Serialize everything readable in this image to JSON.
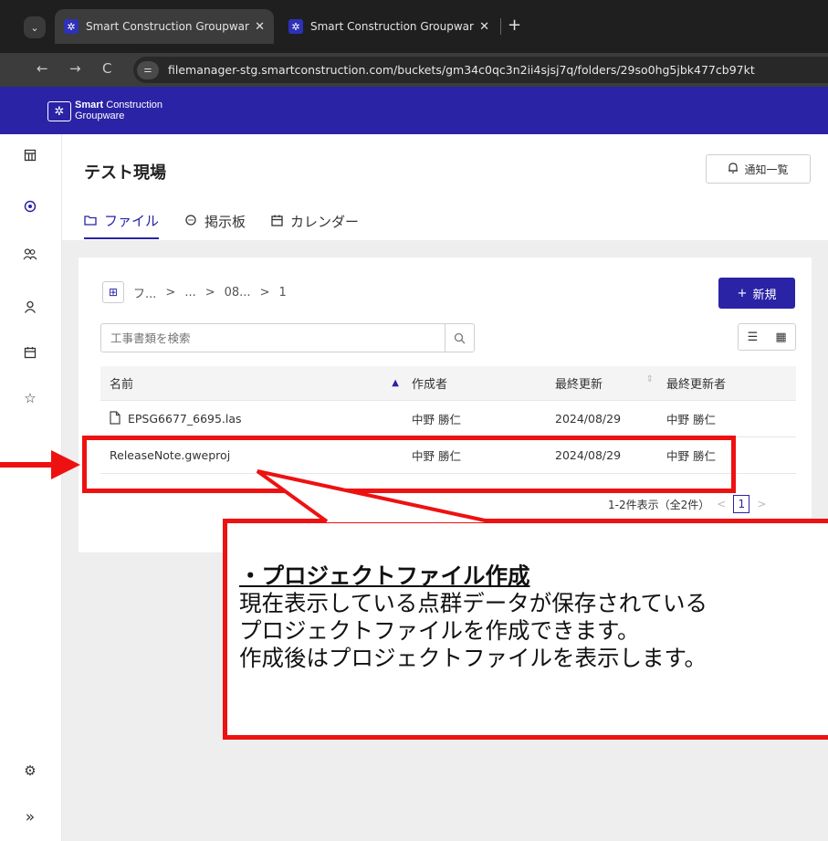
{
  "browser": {
    "tabs": [
      {
        "title": "Smart Construction Groupware",
        "close": "✕"
      },
      {
        "title": "Smart Construction Groupware",
        "close": "✕"
      }
    ],
    "tab_strip_icon": "chevron-down-icon",
    "new_tab": "+",
    "url": "filemanager-stg.smartconstruction.com/buckets/gm34c0qc3n2ii4sjsj7q/folders/29so0hg5jbk477cb97kt"
  },
  "app": {
    "logo_line1_bold": "Smart",
    "logo_line1": " Construction",
    "logo_line2": "Groupware",
    "brand_color": "#2a23a5"
  },
  "page": {
    "title": "テスト現場",
    "notify_label": "通知一覧",
    "tabs": [
      {
        "label": "ファイル",
        "icon": "folder-icon"
      },
      {
        "label": "掲示板",
        "icon": "chat-icon"
      },
      {
        "label": "カレンダー",
        "icon": "calendar-icon"
      }
    ]
  },
  "files": {
    "breadcrumb": [
      "フ...",
      "...",
      "08...",
      "1"
    ],
    "new_label": "新規",
    "search_placeholder": "工事書類を検索",
    "columns": [
      "名前",
      "作成者",
      "最終更新",
      "最終更新者"
    ],
    "rows": [
      {
        "name": "EPSG6677_6695.las",
        "creator": "中野 勝仁",
        "updated": "2024/08/29",
        "updater": "中野 勝仁"
      },
      {
        "name": "ReleaseNote.gweproj",
        "creator": "中野 勝仁",
        "updated": "2024/08/29",
        "updater": "中野 勝仁"
      }
    ],
    "pager_text": "1-2件表示（全2件）",
    "current_page": "1"
  },
  "annotation": {
    "title": "・プロジェクトファイル作成",
    "lines": [
      "現在表示している点群データが保存されている",
      "プロジェクトファイルを作成できます。",
      "作成後はプロジェクトファイルを表示します。"
    ],
    "color": "#ee1111"
  }
}
